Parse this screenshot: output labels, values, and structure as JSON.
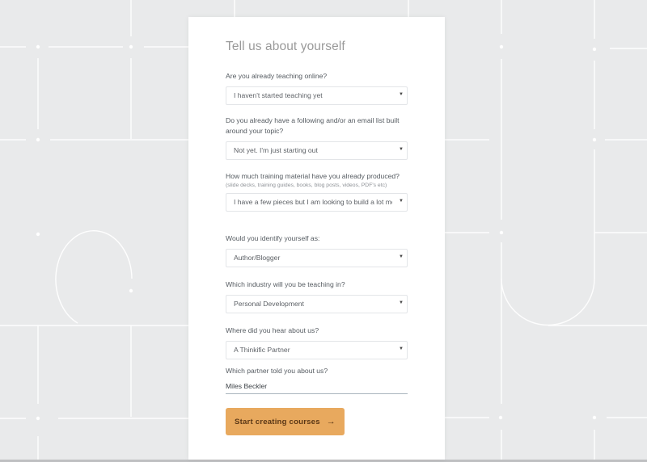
{
  "form": {
    "title": "Tell us about yourself",
    "fields": [
      {
        "label": "Are you already teaching online?",
        "type": "select",
        "value": "I haven't started teaching yet"
      },
      {
        "label": "Do you already have a following and/or an email list built around your topic?",
        "type": "select",
        "value": "Not yet. I'm just starting out"
      },
      {
        "label": "How much training material have you already produced?",
        "hint": "(slide decks, training guides, books, blog posts, videos, PDF's etc)",
        "type": "select",
        "value": "I have a few pieces but I am looking to build a lot more"
      },
      {
        "label": "Would you identify yourself as:",
        "type": "select",
        "value": "Author/Blogger"
      },
      {
        "label": "Which industry will you be teaching in?",
        "type": "select",
        "value": "Personal Development"
      },
      {
        "label": "Where did you hear about us?",
        "type": "select",
        "value": "A Thinkific Partner"
      },
      {
        "label": "Which partner told you about us?",
        "type": "text",
        "value": "Miles Beckler"
      }
    ],
    "submit": {
      "label": "Start creating courses",
      "icon": "arrow-right-icon",
      "arrow_glyph": "→"
    },
    "caret_glyph": "▼"
  },
  "colors": {
    "background": "#e9eaeb",
    "card": "#ffffff",
    "accent_button": "#e8a95e",
    "button_text": "#5a3716",
    "title_text": "#9a9a9a",
    "input_underline": "#a9b4bd"
  }
}
